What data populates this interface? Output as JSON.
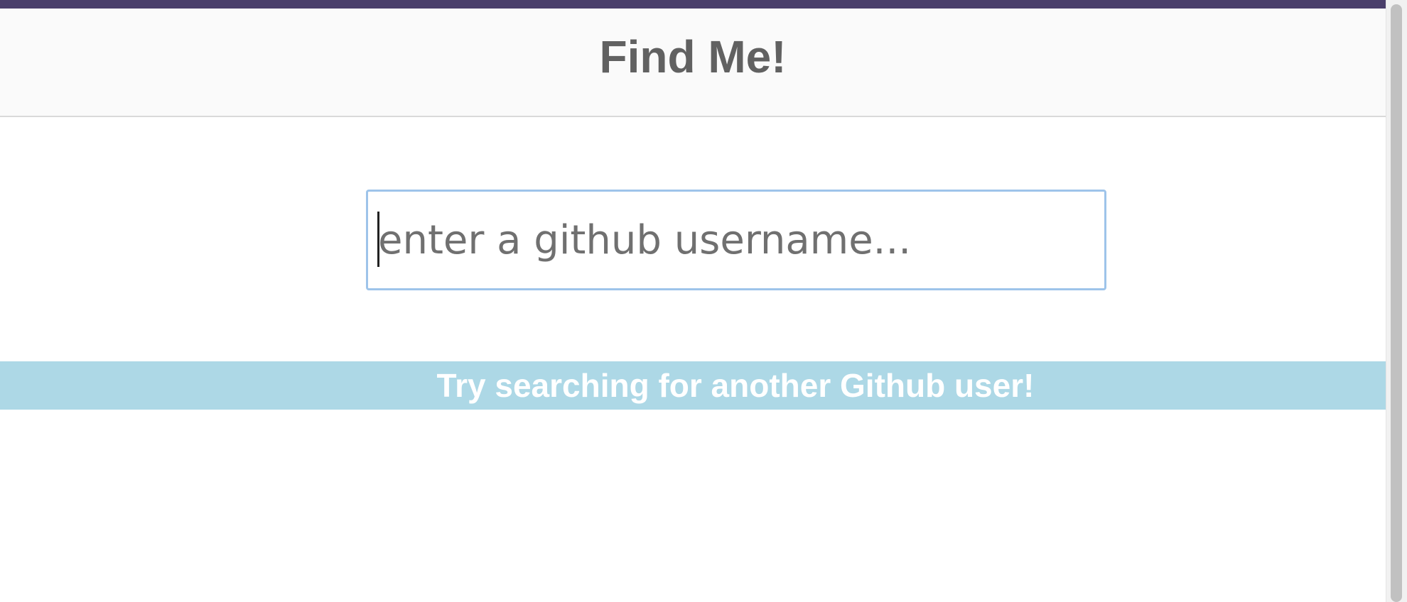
{
  "header": {
    "title": "Find Me!"
  },
  "search": {
    "placeholder": "enter a github username...",
    "value": ""
  },
  "banner": {
    "message": "Try searching for another Github user!"
  },
  "colors": {
    "top_strip": "#4a3f6b",
    "header_bg": "#fafafa",
    "title_text": "#616161",
    "input_border_focus": "#9ec4ea",
    "placeholder_text": "#707070",
    "banner_bg": "#add8e6",
    "banner_text": "#ffffff"
  }
}
